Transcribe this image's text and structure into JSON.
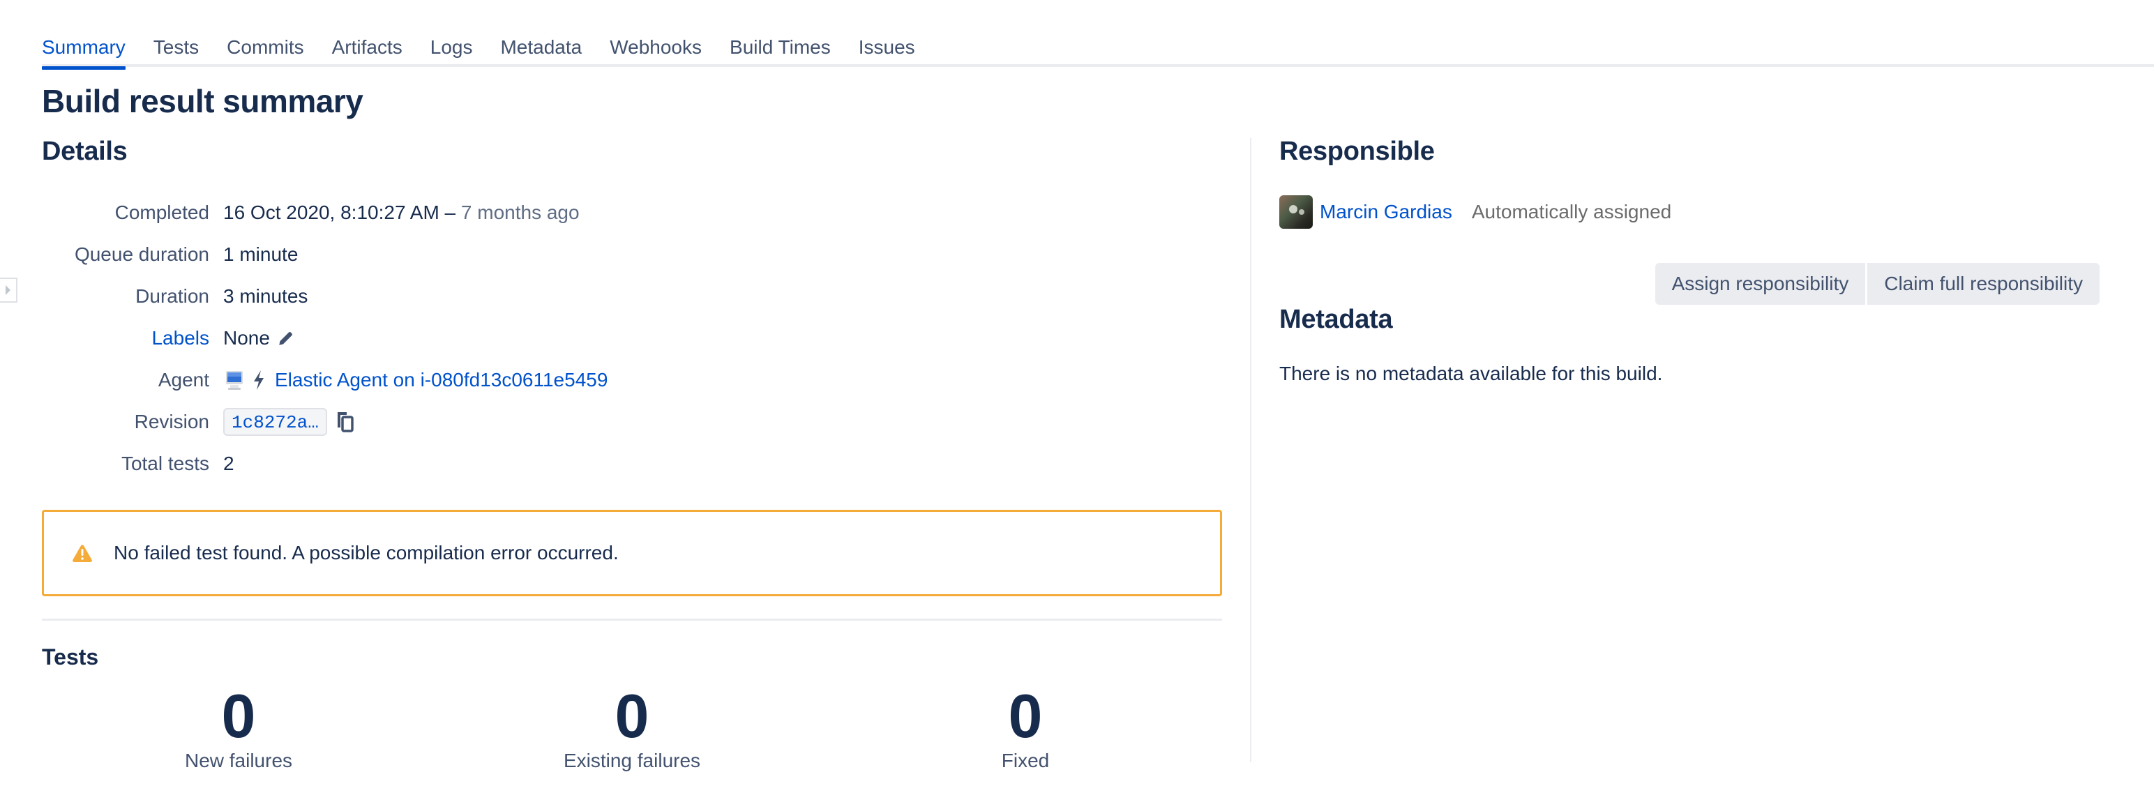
{
  "tabs": [
    {
      "label": "Summary",
      "active": true
    },
    {
      "label": "Tests"
    },
    {
      "label": "Commits"
    },
    {
      "label": "Artifacts"
    },
    {
      "label": "Logs"
    },
    {
      "label": "Metadata"
    },
    {
      "label": "Webhooks"
    },
    {
      "label": "Build Times"
    },
    {
      "label": "Issues"
    }
  ],
  "page_title": "Build result summary",
  "details": {
    "title": "Details",
    "completed": {
      "label": "Completed",
      "value": "16 Oct 2020, 8:10:27 AM",
      "separator": " – ",
      "relative": "7 months ago"
    },
    "queue_duration": {
      "label": "Queue duration",
      "value": "1 minute"
    },
    "duration": {
      "label": "Duration",
      "value": "3 minutes"
    },
    "labels": {
      "label": "Labels",
      "value": "None",
      "icon": "pencil-icon"
    },
    "agent": {
      "label": "Agent",
      "value": "Elastic Agent on i-080fd13c0611e5459",
      "icons": [
        "computer-icon",
        "lightning-icon"
      ]
    },
    "revision": {
      "label": "Revision",
      "value": "1c8272a…",
      "icon": "copy-icon"
    },
    "total_tests": {
      "label": "Total tests",
      "value": "2"
    }
  },
  "warning": {
    "icon": "warning-icon",
    "text": "No failed test found. A possible compilation error occurred.",
    "color": "#f5ab3a"
  },
  "tests": {
    "title": "Tests",
    "stats": [
      {
        "value": "0",
        "label": "New failures"
      },
      {
        "value": "0",
        "label": "Existing failures"
      },
      {
        "value": "0",
        "label": "Fixed"
      }
    ]
  },
  "responsible": {
    "title": "Responsible",
    "name": "Marcin Gardias",
    "note": "Automatically assigned",
    "assign_button": "Assign responsibility",
    "claim_button": "Claim full responsibility"
  },
  "metadata": {
    "title": "Metadata",
    "empty_text": "There is no metadata available for this build."
  },
  "colors": {
    "accent": "#0052cc",
    "text": "#172b4d",
    "muted": "#42526e",
    "warning": "#f5ab3a"
  }
}
